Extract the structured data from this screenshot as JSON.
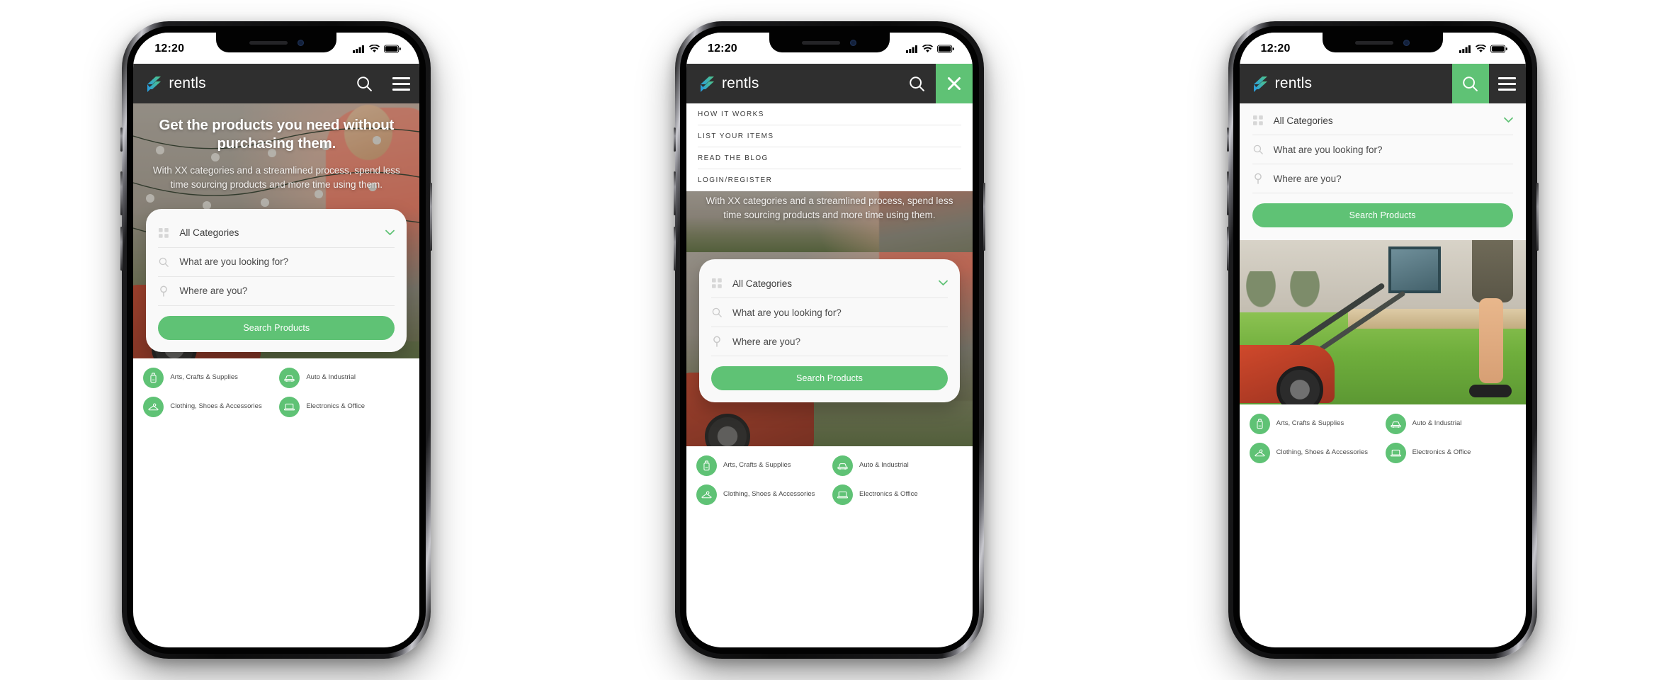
{
  "brand": {
    "name": "rentls",
    "logo_icon": "rentls-logo-icon",
    "accent": "#5fc275",
    "header_bg": "#2f2f2f"
  },
  "status_bar": {
    "time": "12:20",
    "signal_icon": "cellular-signal-icon",
    "wifi_icon": "wifi-icon",
    "battery_icon": "battery-icon"
  },
  "header": {
    "search_icon": "search-icon",
    "menu_icon": "hamburger-menu-icon",
    "close_icon": "close-icon"
  },
  "menu": {
    "items": [
      {
        "label": "HOW IT WORKS"
      },
      {
        "label": "LIST YOUR ITEMS"
      },
      {
        "label": "READ THE BLOG"
      },
      {
        "label": "LOGIN/REGISTER"
      }
    ]
  },
  "hero": {
    "title": "Get the products you need without purchasing them.",
    "subtitle": "With XX categories and a streamlined process, spend less time sourcing products and more time using them."
  },
  "search": {
    "category_value": "All Categories",
    "category_icon": "grid-icon",
    "chevron_icon": "chevron-down-icon",
    "query_placeholder": "What are you looking for?",
    "query_icon": "search-icon",
    "location_placeholder": "Where are you?",
    "location_icon": "map-pin-icon",
    "submit_label": "Search Products"
  },
  "categories": [
    {
      "label": "Arts, Crafts & Supplies",
      "icon": "glue-bottle-icon"
    },
    {
      "label": "Auto & Industrial",
      "icon": "car-icon"
    },
    {
      "label": "Clothing, Shoes & Accessories",
      "icon": "hanger-icon"
    },
    {
      "label": "Electronics & Office",
      "icon": "laptop-icon"
    }
  ],
  "screens": [
    {
      "id": "home",
      "name": "home-screen"
    },
    {
      "id": "menu-open",
      "name": "menu-open-screen"
    },
    {
      "id": "search-open",
      "name": "search-open-screen"
    }
  ]
}
